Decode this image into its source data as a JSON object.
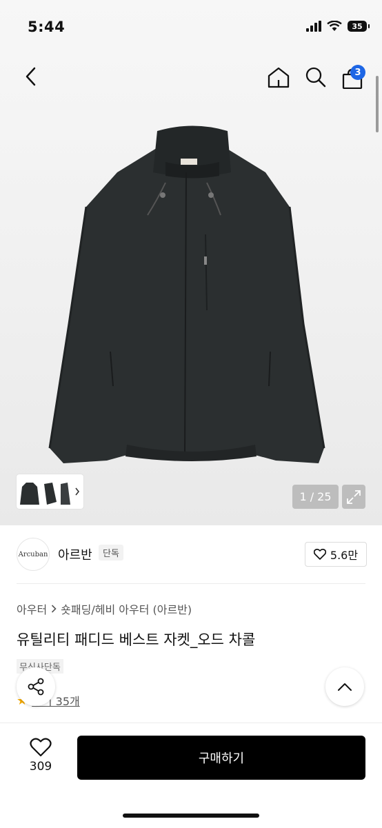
{
  "status_bar": {
    "time": "5:44",
    "battery": "35"
  },
  "nav": {
    "cart_count": "3"
  },
  "gallery": {
    "counter": "1 / 25"
  },
  "brand": {
    "logo_text": "Arcuban",
    "name": "아르반",
    "tag": "단독",
    "likes": "5.6만"
  },
  "breadcrumb": {
    "level1": "아우터",
    "level2": "숏패딩/헤비 아우터 (아르반)"
  },
  "product": {
    "title": "유틸리티 패디드 베스트 자켓_오드 차콜",
    "store_tag": "무신사단독",
    "reviews": "후기 35개"
  },
  "bottom": {
    "wish_count": "309",
    "buy_label": "구매하기"
  },
  "colors": {
    "accent_badge": "#1d66e5",
    "buy_button": "#000000",
    "jacket": "#2b2f30"
  }
}
